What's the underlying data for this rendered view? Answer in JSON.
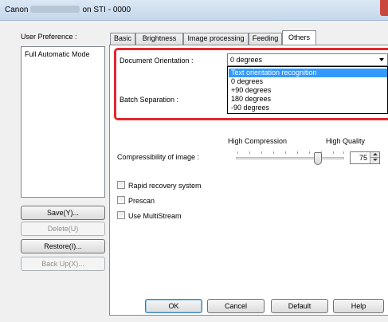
{
  "window": {
    "title_prefix": "Canon",
    "title_suffix": "on STI - 0000"
  },
  "sidebar": {
    "user_preference_label": "User Preference :",
    "list_items": [
      "Full Automatic Mode"
    ],
    "buttons": {
      "save": "Save(Y)...",
      "delete": "Delete(U)",
      "restore": "Restore(I)...",
      "backup": "Back Up(X)..."
    }
  },
  "tabs": [
    "Basic",
    "Brightness",
    "Image processing",
    "Feeding",
    "Others"
  ],
  "active_tab": "Others",
  "others": {
    "document_orientation_label": "Document Orientation :",
    "document_orientation_value": "0 degrees",
    "orientation_options": [
      "Text orientation recognition",
      "0 degrees",
      "+90 degrees",
      "180 degrees",
      "-90 degrees"
    ],
    "highlighted_option": "Text orientation recognition",
    "batch_separation_label": "Batch Separation :",
    "compression_low_label": "High Compression",
    "compression_high_label": "High Quality",
    "compressibility_label": "Compressibility of image :",
    "compressibility_value": "75",
    "checkboxes": {
      "rapid_recovery": "Rapid recovery system",
      "prescan": "Prescan",
      "multistream": "Use MultiStream"
    }
  },
  "footer": {
    "ok": "OK",
    "cancel": "Cancel",
    "default": "Default",
    "help": "Help"
  },
  "colors": {
    "highlight_frame": "#e4262d",
    "selection": "#3399ff"
  }
}
